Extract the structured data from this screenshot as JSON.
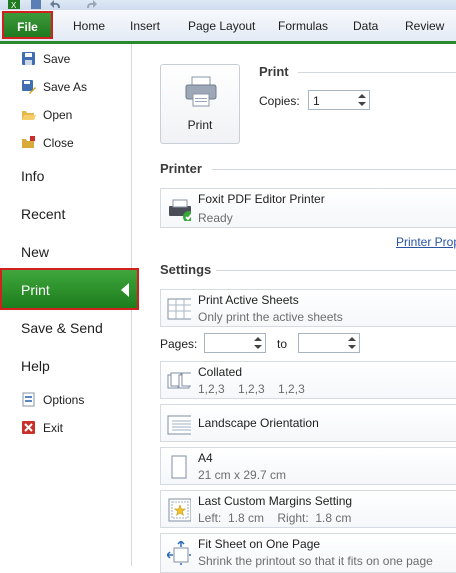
{
  "ribbon": {
    "file_label": "File",
    "tabs": [
      "Home",
      "Insert",
      "Page Layout",
      "Formulas",
      "Data",
      "Review"
    ]
  },
  "menu": {
    "small_top": [
      {
        "label": "Save",
        "icon": "save-icon"
      },
      {
        "label": "Save As",
        "icon": "save-as-icon"
      },
      {
        "label": "Open",
        "icon": "open-folder-icon"
      },
      {
        "label": "Close",
        "icon": "close-document-icon"
      }
    ],
    "info": "Info",
    "recent": "Recent",
    "new": "New",
    "print": "Print",
    "save_send": "Save & Send",
    "help": "Help",
    "options": "Options",
    "exit": "Exit"
  },
  "print": {
    "section_title": "Print",
    "button_label": "Print",
    "copies_label": "Copies:",
    "copies_value": "1"
  },
  "printer": {
    "section_title": "Printer",
    "name": "Foxit PDF Editor Printer",
    "status": "Ready",
    "properties_link": "Printer Prop"
  },
  "settings": {
    "section_title": "Settings",
    "what": {
      "title": "Print Active Sheets",
      "sub": "Only print the active sheets"
    },
    "pages_label": "Pages:",
    "to_label": "to",
    "pages_from": "",
    "pages_to": "",
    "collate": {
      "title": "Collated",
      "sub": "1,2,3    1,2,3    1,2,3"
    },
    "orientation": {
      "title": "Landscape Orientation"
    },
    "paper": {
      "title": "A4",
      "sub": "21 cm x 29.7 cm"
    },
    "margins": {
      "title": "Last Custom Margins Setting",
      "sub": "Left:  1.8 cm    Right:  1.8 cm"
    },
    "scaling": {
      "title": "Fit Sheet on One Page",
      "sub": "Shrink the printout so that it fits on one page"
    }
  },
  "colors": {
    "accent_green": "#2b8a2b",
    "highlight_red": "#d21f1f",
    "link_blue": "#2a54a0"
  }
}
